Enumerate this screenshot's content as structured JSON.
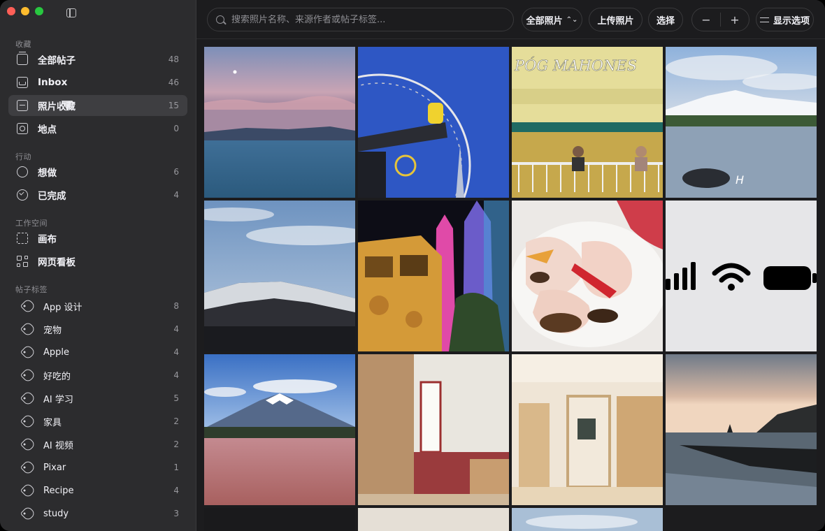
{
  "window": {
    "traffic_lights": [
      "close",
      "minimize",
      "zoom"
    ]
  },
  "sidebar": {
    "sections": [
      {
        "title": "收藏",
        "items": [
          {
            "label": "全部帖子",
            "count": "48",
            "icon": "stack-icon"
          },
          {
            "label": "Inbox",
            "count": "46",
            "icon": "inbox-icon"
          },
          {
            "label": "照片收藏",
            "count": "15",
            "icon": "photo-icon",
            "active": true
          },
          {
            "label": "地点",
            "count": "0",
            "icon": "map-icon"
          }
        ]
      },
      {
        "title": "行动",
        "items": [
          {
            "label": "想做",
            "count": "6",
            "icon": "circle-icon"
          },
          {
            "label": "已完成",
            "count": "4",
            "icon": "check-circle-icon"
          }
        ]
      },
      {
        "title": "工作空间",
        "items": [
          {
            "label": "画布",
            "count": "",
            "icon": "canvas-icon"
          },
          {
            "label": "网页看板",
            "count": "",
            "icon": "grid-icon"
          }
        ]
      },
      {
        "title": "帖子标签",
        "items": [
          {
            "label": "App 设计",
            "count": "8",
            "icon": "tag-icon"
          },
          {
            "label": "宠物",
            "count": "4",
            "icon": "tag-icon"
          },
          {
            "label": "Apple",
            "count": "4",
            "icon": "tag-icon"
          },
          {
            "label": "好吃的",
            "count": "4",
            "icon": "tag-icon"
          },
          {
            "label": "AI 学习",
            "count": "5",
            "icon": "tag-icon"
          },
          {
            "label": "家具",
            "count": "2",
            "icon": "tag-icon"
          },
          {
            "label": "AI 视频",
            "count": "2",
            "icon": "tag-icon"
          },
          {
            "label": "Pixar",
            "count": "1",
            "icon": "tag-icon"
          },
          {
            "label": "Recipe",
            "count": "4",
            "icon": "tag-icon"
          },
          {
            "label": "study",
            "count": "3",
            "icon": "tag-icon"
          }
        ]
      }
    ]
  },
  "toolbar": {
    "search_placeholder": "搜索照片名称、来源作者或帖子标签...",
    "filter_label": "全部照片",
    "upload_label": "上传照片",
    "select_label": "选择",
    "zoom_out": "−",
    "zoom_in": "+",
    "display_label": "显示选项"
  },
  "photos": [
    {
      "id": "lake-dusk",
      "caption": ""
    },
    {
      "id": "ferris-wheel",
      "caption": ""
    },
    {
      "id": "storefront",
      "caption": "PÓG MAHONES"
    },
    {
      "id": "mountain-lake",
      "caption": ""
    },
    {
      "id": "snowy-ridge",
      "caption": ""
    },
    {
      "id": "night-theme-park",
      "caption": ""
    },
    {
      "id": "shrimp-dish",
      "caption": ""
    },
    {
      "id": "status-icons",
      "caption": ""
    },
    {
      "id": "mount-fuji",
      "caption": ""
    },
    {
      "id": "interior-red-sofa",
      "caption": ""
    },
    {
      "id": "interior-wood",
      "caption": ""
    },
    {
      "id": "sea-stacks",
      "caption": ""
    }
  ]
}
